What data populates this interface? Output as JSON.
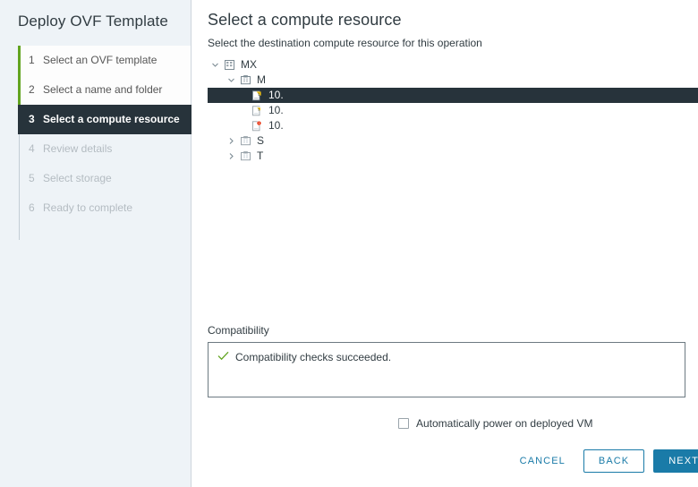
{
  "wizard": {
    "title": "Deploy OVF Template",
    "steps": [
      {
        "num": "1",
        "label": "Select an OVF template",
        "state": "done"
      },
      {
        "num": "2",
        "label": "Select a name and folder",
        "state": "done"
      },
      {
        "num": "3",
        "label": "Select a compute resource",
        "state": "active"
      },
      {
        "num": "4",
        "label": "Review details",
        "state": "pending"
      },
      {
        "num": "5",
        "label": "Select storage",
        "state": "pending"
      },
      {
        "num": "6",
        "label": "Ready to complete",
        "state": "pending"
      }
    ]
  },
  "header": {
    "title": "Select a compute resource",
    "subtitle": "Select the destination compute resource for this operation",
    "close_icon": "close-icon"
  },
  "tree": {
    "nodes": [
      {
        "label": "MX",
        "icon": "datacenter-icon",
        "twisty": "chevron-down",
        "indent": 1,
        "selected": false,
        "badge": "none"
      },
      {
        "label": "M",
        "icon": "cluster-icon",
        "twisty": "chevron-down",
        "indent": 2,
        "selected": false,
        "badge": "none"
      },
      {
        "label": "10.",
        "icon": "host-icon",
        "twisty": "none",
        "indent": 3,
        "selected": true,
        "badge": "warning"
      },
      {
        "label": "10.",
        "icon": "host-icon",
        "twisty": "none",
        "indent": 3,
        "selected": false,
        "badge": "warning"
      },
      {
        "label": "10.",
        "icon": "host-icon",
        "twisty": "none",
        "indent": 3,
        "selected": false,
        "badge": "alert"
      },
      {
        "label": "S",
        "icon": "cluster-icon",
        "twisty": "chevron-right",
        "indent": 2,
        "selected": false,
        "badge": "none"
      },
      {
        "label": "T",
        "icon": "cluster-icon",
        "twisty": "chevron-right",
        "indent": 2,
        "selected": false,
        "badge": "none"
      }
    ]
  },
  "compatibility": {
    "label": "Compatibility",
    "message": "Compatibility checks succeeded.",
    "status_icon": "check-icon"
  },
  "options": {
    "auto_power_label": "Automatically power on deployed VM",
    "auto_power_checked": false
  },
  "footer": {
    "cancel_label": "CANCEL",
    "back_label": "BACK",
    "next_label": "NEXT"
  },
  "colors": {
    "accent_blue": "#1a7ba8",
    "active_dark": "#27333b",
    "success_green": "#62a420",
    "warning_yellow": "#f6c40e",
    "alert_red": "#e62700",
    "sidebar_bg": "#eef3f7"
  }
}
